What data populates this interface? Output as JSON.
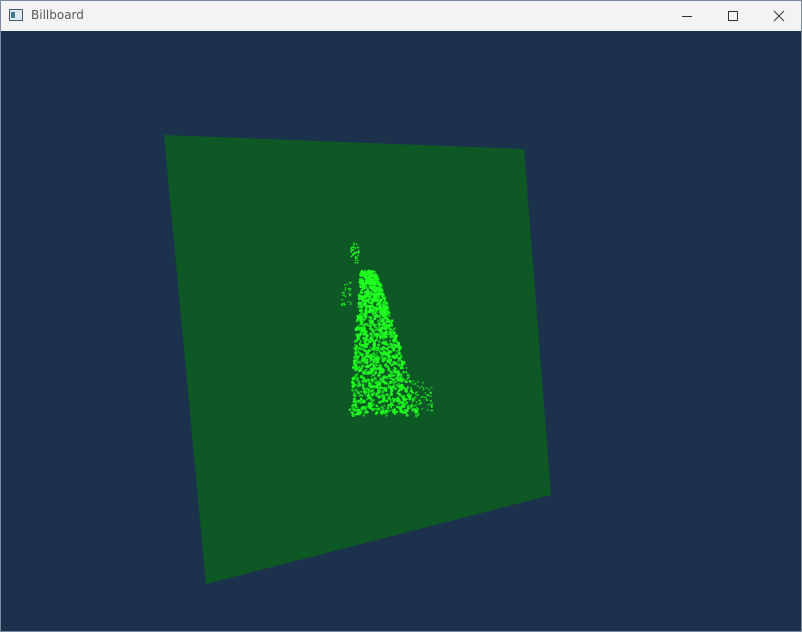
{
  "window": {
    "title": "Billboard",
    "controls": {
      "minimize": "minimize-icon",
      "maximize": "maximize-icon",
      "close": "close-icon"
    }
  },
  "scene": {
    "background_color": "#1b314c",
    "billboard_color": "#0e5826",
    "sprite_color": "#20ff20"
  }
}
